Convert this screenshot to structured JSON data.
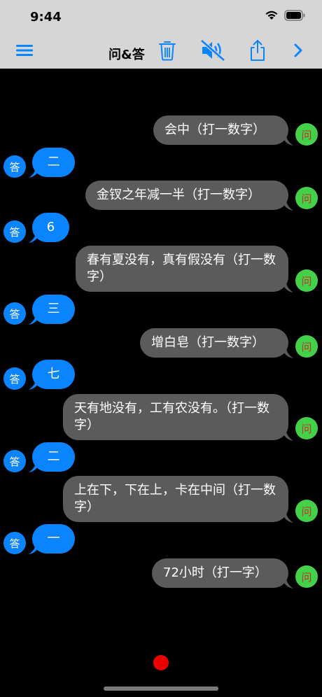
{
  "status": {
    "time": "9:44"
  },
  "nav": {
    "title": "问&答"
  },
  "labels": {
    "question": "问",
    "answer": "答"
  },
  "messages": [
    {
      "q": "会中（打一数字）",
      "a": "二"
    },
    {
      "q": "金钗之年减一半（打一数字）",
      "a": "6"
    },
    {
      "q": "春有夏没有，真有假没有（打一数字）",
      "a": "三"
    },
    {
      "q": "增白皂（打一数字）",
      "a": "七"
    },
    {
      "q": "天有地没有，工有农没有。（打一数字）",
      "a": "二"
    },
    {
      "q": "上在下，下在上，卡在中间（打一数字）",
      "a": "一"
    },
    {
      "q": "72小时（打一字）"
    }
  ],
  "colors": {
    "accent": "#0b84ff",
    "question_bubble": "#5b5b5b",
    "question_avatar": "#44d14a",
    "record": "#ee0000"
  },
  "icons": [
    "menu-icon",
    "trash-icon",
    "speaker-muted-icon",
    "share-icon",
    "chevron-right-icon"
  ]
}
